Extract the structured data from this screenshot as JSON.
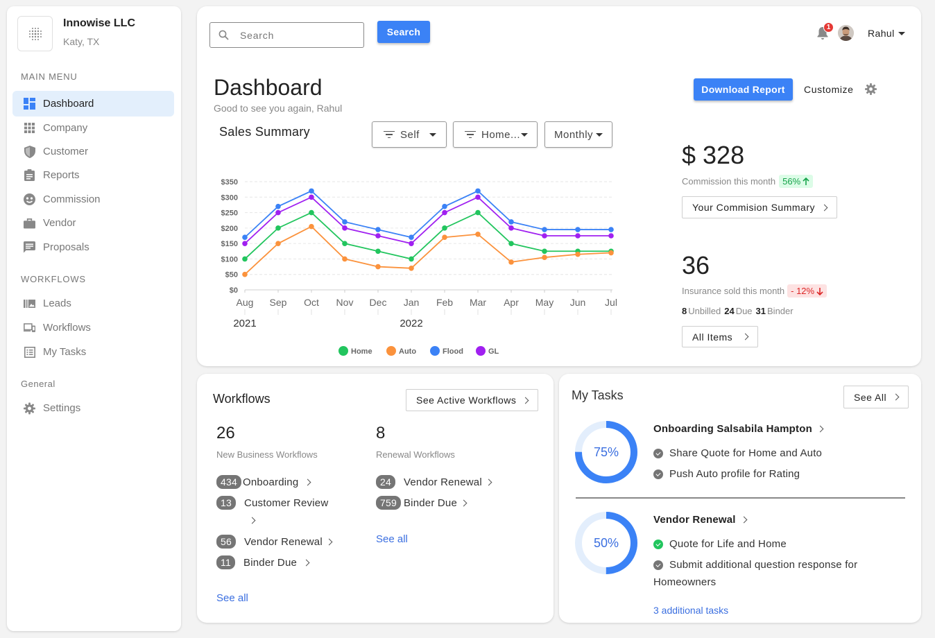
{
  "company": {
    "name": "Innowise LLC",
    "location": "Katy, TX"
  },
  "sidebar": {
    "main_menu_label": "MAIN MENU",
    "main_items": [
      {
        "label": "Dashboard",
        "icon": "dashboard-icon"
      },
      {
        "label": "Company",
        "icon": "apps-grid-icon"
      },
      {
        "label": "Customer",
        "icon": "shield-icon"
      },
      {
        "label": "Reports",
        "icon": "clipboard-icon"
      },
      {
        "label": "Commission",
        "icon": "face-icon"
      },
      {
        "label": "Vendor",
        "icon": "briefcase-icon"
      },
      {
        "label": "Proposals",
        "icon": "chat-icon"
      }
    ],
    "workflows_label": "WORKFLOWS",
    "workflow_items": [
      {
        "label": "Leads",
        "icon": "leads-icon"
      },
      {
        "label": "Workflows",
        "icon": "devices-icon"
      },
      {
        "label": "My Tasks",
        "icon": "list-icon"
      }
    ],
    "general_label": "General",
    "general_items": [
      {
        "label": "Settings",
        "icon": "gear-icon"
      }
    ]
  },
  "header": {
    "search_placeholder": "Search",
    "search_button": "Search",
    "notification_count": "1",
    "user_name": "Rahul"
  },
  "dashboard": {
    "title": "Dashboard",
    "subtitle": "Good to see you again, Rahul",
    "download_button": "Download Report",
    "customize_label": "Customize"
  },
  "sales": {
    "title": "Sales Summary",
    "filter_self": "Self",
    "filter_home": "Home...",
    "filter_period": "Monthly"
  },
  "chart_data": {
    "type": "line",
    "categories": [
      "Aug",
      "Sep",
      "Oct",
      "Nov",
      "Dec",
      "Jan",
      "Feb",
      "Mar",
      "Apr",
      "May",
      "Jun",
      "Jul"
    ],
    "year_labels": [
      "2021",
      "2022"
    ],
    "y_ticks": [
      "$0",
      "$50",
      "$100",
      "$150",
      "$200",
      "$250",
      "$300",
      "$350"
    ],
    "ylim": [
      0,
      350
    ],
    "grid": true,
    "legend_position": "bottom",
    "series": [
      {
        "name": "Home",
        "color": "#22c55e",
        "values": [
          100,
          200,
          250,
          150,
          125,
          100,
          200,
          250,
          150,
          125,
          125,
          125
        ]
      },
      {
        "name": "Auto",
        "color": "#fb923c",
        "values": [
          50,
          150,
          205,
          100,
          75,
          70,
          170,
          180,
          90,
          105,
          115,
          120
        ]
      },
      {
        "name": "Flood",
        "color": "#3b82f6",
        "values": [
          170,
          270,
          320,
          220,
          195,
          170,
          270,
          320,
          220,
          195,
          195,
          195
        ]
      },
      {
        "name": "GL",
        "color": "#a020f0",
        "values": [
          150,
          250,
          300,
          200,
          175,
          150,
          250,
          300,
          200,
          175,
          175,
          175
        ]
      }
    ]
  },
  "commission": {
    "amount": "$ 328",
    "label": "Commission this month",
    "change": "56%",
    "summary_button": "Your Commision Summary"
  },
  "insurance": {
    "count": "36",
    "label": "Insurance sold this month",
    "change": "- 12%",
    "unbilled_count": "8",
    "unbilled_label": "Unbilled",
    "due_count": "24",
    "due_label": "Due",
    "binder_count": "31",
    "binder_label": "Binder",
    "all_items_button": "All Items"
  },
  "workflows": {
    "title": "Workflows",
    "see_active_button": "See Active Workflows",
    "new_count": "26",
    "new_label": "New Business Workflows",
    "renewal_count": "8",
    "renewal_label": "Renewal Workflows",
    "new_items": [
      {
        "count": "434",
        "label": "Onboarding"
      },
      {
        "count": "13",
        "label": "Customer Review"
      },
      {
        "count": "56",
        "label": "Vendor Renewal"
      },
      {
        "count": "11",
        "label": "Binder Due"
      }
    ],
    "renewal_items": [
      {
        "count": "24",
        "label": "Vendor Renewal"
      },
      {
        "count": "759",
        "label": "Binder Due"
      }
    ],
    "see_all_new": "See all",
    "see_all_renewal": "See all"
  },
  "tasks": {
    "title": "My Tasks",
    "see_all_button": "See All",
    "groups": [
      {
        "title": "Onboarding Salsabila Hampton",
        "progress": 75,
        "progress_label": "75%",
        "items": [
          {
            "label": "Share Quote for Home and Auto",
            "status": "done-gray"
          },
          {
            "label": "Push Auto profile for Rating",
            "status": "done-gray"
          }
        ]
      },
      {
        "title": "Vendor Renewal",
        "progress": 50,
        "progress_label": "50%",
        "items": [
          {
            "label": "Quote for Life and Home",
            "status": "done-green"
          },
          {
            "label": "Submit additional question response for",
            "label2": "Homeowners",
            "status": "done-gray"
          }
        ]
      }
    ],
    "additional_link": "3 additional tasks"
  }
}
